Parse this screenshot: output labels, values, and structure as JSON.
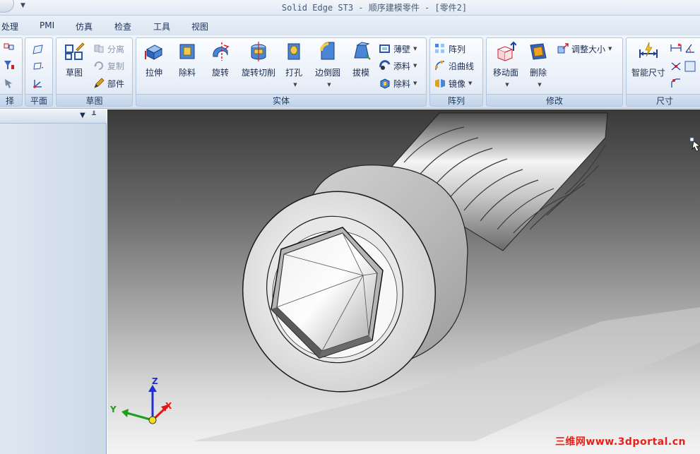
{
  "titlebar": {
    "title": "Solid Edge ST3 - 顺序建模零件 - [零件2]"
  },
  "menu_tabs": [
    "处理",
    "PMI",
    "仿真",
    "检查",
    "工具",
    "视图"
  ],
  "ribbon": {
    "plane_group": {
      "label": "平面"
    },
    "sketch_group": {
      "label": "草图",
      "sketch_btn": "草图",
      "separate_btn": "分离",
      "copy_btn": "复制",
      "part_btn": "部件"
    },
    "solid_group": {
      "label": "实体",
      "extrude": "拉伸",
      "cut": "除料",
      "revolve": "旋转",
      "revolve_cut": "旋转切削",
      "hole": "打孔",
      "round": "边倒圆",
      "draft": "拔模",
      "thin_wall": "薄壁",
      "add_material": "添料",
      "remove_material": "除料"
    },
    "pattern_group": {
      "label": "阵列",
      "pattern": "阵列",
      "along_curve": "沿曲线",
      "mirror": "镜像"
    },
    "modify_group": {
      "label": "修改",
      "move_face": "移动面",
      "delete": "删除",
      "resize": "调整大小"
    },
    "dimension_group": {
      "label": "尺寸",
      "smart_dimension": "智能尺寸"
    }
  },
  "axes": {
    "x": "X",
    "y": "Y",
    "z": "Z"
  },
  "watermark": "三维网www.3dportal.cn",
  "colors": {
    "accent": "#1e3a6e",
    "axis_x": "#e01515",
    "axis_y": "#1aa01a",
    "axis_z": "#1f2fd0",
    "watermark": "#e8201a"
  }
}
